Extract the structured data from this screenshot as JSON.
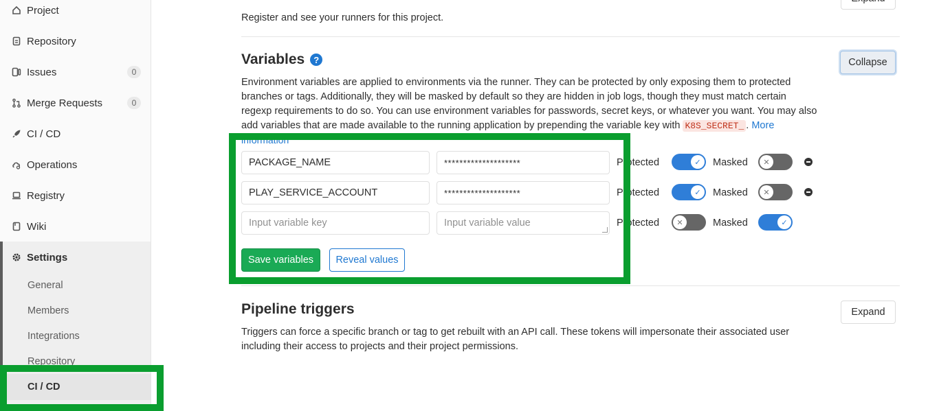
{
  "sidebar": {
    "items": [
      {
        "label": "Project",
        "icon": "home-icon"
      },
      {
        "label": "Repository",
        "icon": "document-icon"
      },
      {
        "label": "Issues",
        "icon": "issues-icon",
        "count": "0"
      },
      {
        "label": "Merge Requests",
        "icon": "git-merge-icon",
        "count": "0"
      },
      {
        "label": "CI / CD",
        "icon": "rocket-icon"
      },
      {
        "label": "Operations",
        "icon": "cloud-gear-icon"
      },
      {
        "label": "Registry",
        "icon": "laptop-icon"
      },
      {
        "label": "Wiki",
        "icon": "book-icon"
      }
    ],
    "settings": {
      "label": "Settings",
      "icon": "gear-icon"
    },
    "settings_sub": [
      "General",
      "Members",
      "Integrations",
      "Repository",
      "CI / CD"
    ]
  },
  "runners": {
    "description": "Register and see your runners for this project.",
    "expand_label": "Expand"
  },
  "variables": {
    "title": "Variables",
    "help_icon": "question-circle-icon",
    "collapse_label": "Collapse",
    "desc_line1": "Environment variables are applied to environments via the runner. They can be protected by only exposing them to protected",
    "desc_line2": "branches or tags. Additionally, they will be masked by default so they are hidden in job logs, though they must match certain",
    "desc_line3": "regexp requirements to do so. You can use environment variables for passwords, secret keys, or whatever you want. You may also",
    "desc_line4": "add variables that are made available to the running application by prepending the variable key with",
    "code": "K8S_SECRET_",
    "more": "More",
    "information": "information",
    "rows": [
      {
        "key": "PACKAGE_NAME",
        "value": "********************",
        "protected_label": "Protected",
        "protected": true,
        "masked_label": "Masked",
        "masked": false
      },
      {
        "key": "PLAY_SERVICE_ACCOUNT",
        "value": "********************",
        "protected_label": "Protected",
        "protected": true,
        "masked_label": "Masked",
        "masked": false
      }
    ],
    "new_row": {
      "key_placeholder": "Input variable key",
      "value_placeholder": "Input variable value",
      "protected_label": "Protected",
      "protected": false,
      "masked_label": "Masked",
      "masked": true
    },
    "save_label": "Save variables",
    "reveal_label": "Reveal values"
  },
  "triggers": {
    "title": "Pipeline triggers",
    "expand_label": "Expand",
    "desc_line1": "Triggers can force a specific branch or tag to get rebuilt with an API call. These tokens will impersonate their associated user",
    "desc_line2": "including their access to projects and their project permissions."
  },
  "colors": {
    "highlight": "#0a9e2f",
    "accent": "#1f78d1",
    "success": "#1aaa55"
  }
}
